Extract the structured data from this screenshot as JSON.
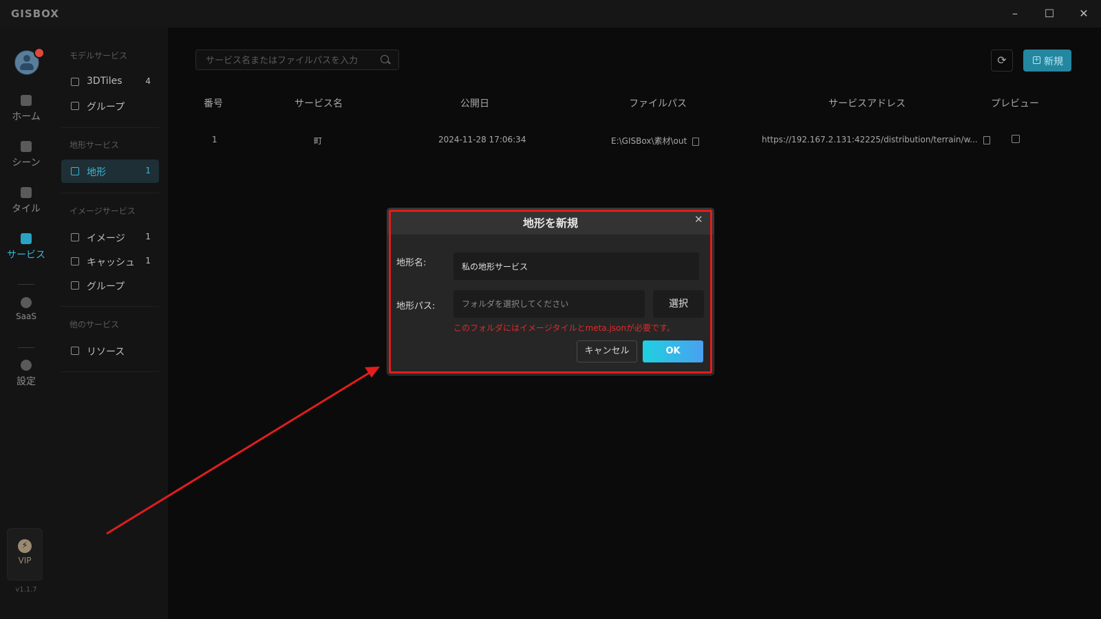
{
  "app": {
    "logo": "GISBOX",
    "window_controls": {
      "minimize": "–",
      "maximize": "☐",
      "close": "✕"
    },
    "version": "v1.1.7"
  },
  "rail": {
    "items": [
      {
        "label": "ホーム",
        "icon": "home-icon"
      },
      {
        "label": "シーン",
        "icon": "scene-icon"
      },
      {
        "label": "タイル",
        "icon": "tile-icon"
      },
      {
        "label": "サービス",
        "icon": "service-icon"
      },
      {
        "label": "SaaS",
        "icon": "lock-icon"
      },
      {
        "label": "設定",
        "icon": "gear-icon"
      }
    ],
    "vip": {
      "label": "VIP",
      "icon_glyph": "⚡"
    }
  },
  "subnav": {
    "sections": [
      {
        "title": "モデルサービス",
        "items": [
          {
            "label": "3DTiles",
            "count": "4"
          },
          {
            "label": "グループ",
            "count": ""
          }
        ]
      },
      {
        "title": "地形サービス",
        "items": [
          {
            "label": "地形",
            "count": "1"
          }
        ]
      },
      {
        "title": "イメージサービス",
        "items": [
          {
            "label": "イメージ",
            "count": "1"
          },
          {
            "label": "キャッシュ",
            "count": "1"
          },
          {
            "label": "グループ",
            "count": ""
          }
        ]
      },
      {
        "title": "他のサービス",
        "items": [
          {
            "label": "リソース",
            "count": ""
          }
        ]
      }
    ]
  },
  "toolbar": {
    "search_placeholder": "サービス名またはファイルパスを入力",
    "refresh_glyph": "⟳",
    "new_label": "新規",
    "new_glyph": "+"
  },
  "table": {
    "headers": [
      "番号",
      "サービス名",
      "公開日",
      "ファイルパス",
      "サービスアドレス",
      "プレビュー"
    ],
    "rows": [
      {
        "no": "1",
        "name": "町",
        "date": "2024-11-28 17:06:34",
        "path": "E:\\GISBox\\素材\\out",
        "address": "https://192.167.2.131:42225/distribution/terrain/w..."
      }
    ]
  },
  "dialog": {
    "title": "地形を新規",
    "close_glyph": "✕",
    "name_label": "地形名:",
    "name_value": "私の地形サービス",
    "path_label": "地形パス:",
    "path_placeholder": "フォルダを選択してください",
    "select_label": "選択",
    "hint": "このフォルダにはイメージタイルとmeta.jsonが必要です。",
    "cancel_label": "キャンセル",
    "ok_label": "OK"
  },
  "colors": {
    "accent": "#2aa3c2",
    "annotation_red": "#e21d1d",
    "hint_red": "#e12a2a"
  }
}
